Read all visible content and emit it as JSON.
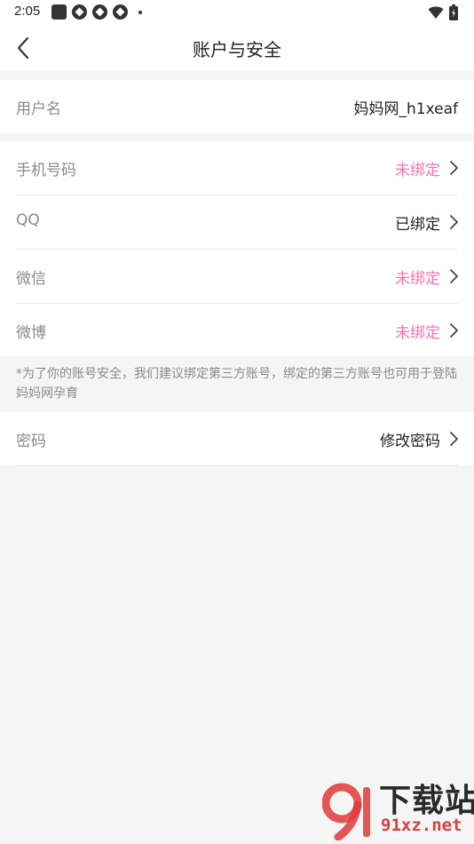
{
  "status_bar": {
    "time": "2:05"
  },
  "nav": {
    "title": "账户与安全"
  },
  "username_row": {
    "label": "用户名",
    "value": "妈妈网_h1xeaf"
  },
  "bindings": [
    {
      "label": "手机号码",
      "value": "未绑定"
    },
    {
      "label": "QQ",
      "value": "已绑定"
    },
    {
      "label": "微信",
      "value": "未绑定"
    },
    {
      "label": "微博",
      "value": "未绑定"
    }
  ],
  "note": "*为了你的账号安全，我们建议绑定第三方账号，绑定的第三方账号也可用于登陆妈妈网孕育",
  "password_row": {
    "label": "密码",
    "value": "修改密码"
  },
  "watermark": {
    "logo_text": "91",
    "cn": "下载站",
    "en": "91xz.net"
  },
  "colors": {
    "unbound": "#ff6fae",
    "bound": "#222222",
    "background": "#f5f5f5"
  },
  "icons": [
    "back-arrow-icon",
    "chevron-right-icon",
    "wifi-icon",
    "battery-icon"
  ]
}
